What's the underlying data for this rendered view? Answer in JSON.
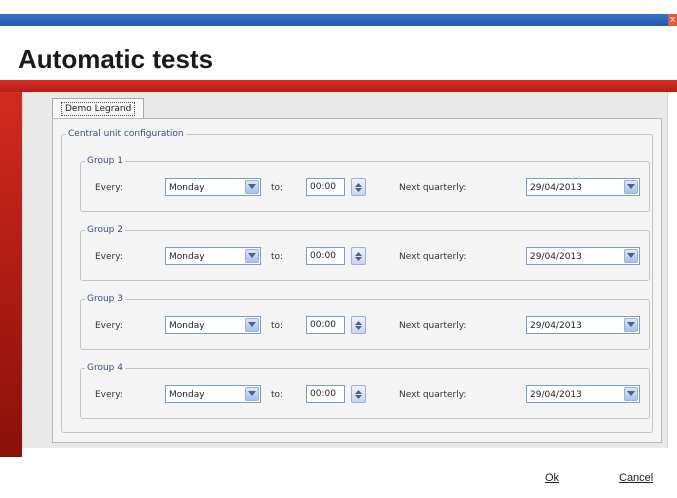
{
  "window": {
    "close_glyph": "x"
  },
  "header": {
    "title": "Automatic tests"
  },
  "tab": {
    "label": "Demo Legrand"
  },
  "central": {
    "legend": "Central unit configuration"
  },
  "labels": {
    "every": "Every:",
    "to": "to:",
    "next": "Next quarterly:"
  },
  "groups": [
    {
      "name": "Group 1",
      "day": "Monday",
      "time": "00:00",
      "date": "29/04/2013"
    },
    {
      "name": "Group 2",
      "day": "Monday",
      "time": "00:00",
      "date": "29/04/2013"
    },
    {
      "name": "Group 3",
      "day": "Monday",
      "time": "00:00",
      "date": "29/04/2013"
    },
    {
      "name": "Group 4",
      "day": "Monday",
      "time": "00:00",
      "date": "29/04/2013"
    }
  ],
  "footer": {
    "ok": "Ok",
    "cancel": "Cancel"
  },
  "colors": {
    "accent_red": "#c8281c",
    "title_blue": "#2a63b8"
  }
}
